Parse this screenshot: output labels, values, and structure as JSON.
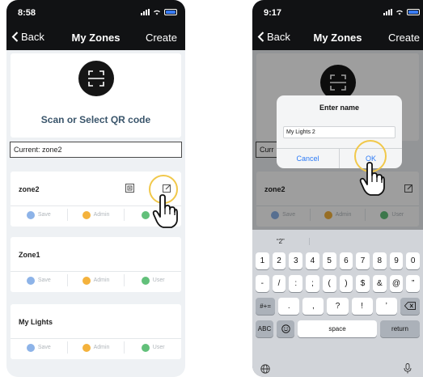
{
  "left": {
    "status_time": "8:58",
    "nav": {
      "back": "Back",
      "title": "My Zones",
      "create": "Create"
    },
    "scan_label": "Scan or Select QR code",
    "current": "Current:  zone2",
    "zones": [
      {
        "name": "zone2",
        "save": "Save",
        "admin": "Admin",
        "user": "User"
      },
      {
        "name": "Zone1",
        "save": "Save",
        "admin": "Admin",
        "user": "User"
      },
      {
        "name": "My Lights",
        "save": "Save",
        "admin": "Admin",
        "user": "User"
      }
    ]
  },
  "right": {
    "status_time": "9:17",
    "nav": {
      "back": "Back",
      "title": "My Zones",
      "create": "Create"
    },
    "current_partial": "Curr",
    "zone": {
      "name": "zone2",
      "save": "Save",
      "admin": "Admin",
      "user": "User"
    },
    "dialog": {
      "title": "Enter name",
      "input_value": "My Lights 2",
      "cancel": "Cancel",
      "ok": "OK"
    },
    "keyboard": {
      "suggestion": "“2”",
      "row1": [
        "1",
        "2",
        "3",
        "4",
        "5",
        "6",
        "7",
        "8",
        "9",
        "0"
      ],
      "row2": [
        "-",
        "/",
        ":",
        ";",
        "(",
        ")",
        "$",
        "&",
        "@",
        "”"
      ],
      "row3_left": "#+=",
      "row3": [
        ".",
        ",",
        "?",
        "!",
        "’"
      ],
      "row4": {
        "abc": "ABC",
        "space": "space",
        "return": "return"
      }
    }
  },
  "colors": {
    "navbar": "#111214",
    "accent": "#2d7bf6",
    "highlight": "#f1c84a",
    "save": "#8db3e8",
    "admin": "#f4b23c",
    "user": "#62c07a"
  },
  "icons": [
    "chevron-left-icon",
    "signal-icon",
    "wifi-icon",
    "battery-icon",
    "qr-scan-icon",
    "qr-code-icon",
    "edit-icon",
    "pointing-hand-icon",
    "emoji-icon",
    "delete-key-icon",
    "globe-icon",
    "microphone-icon"
  ]
}
